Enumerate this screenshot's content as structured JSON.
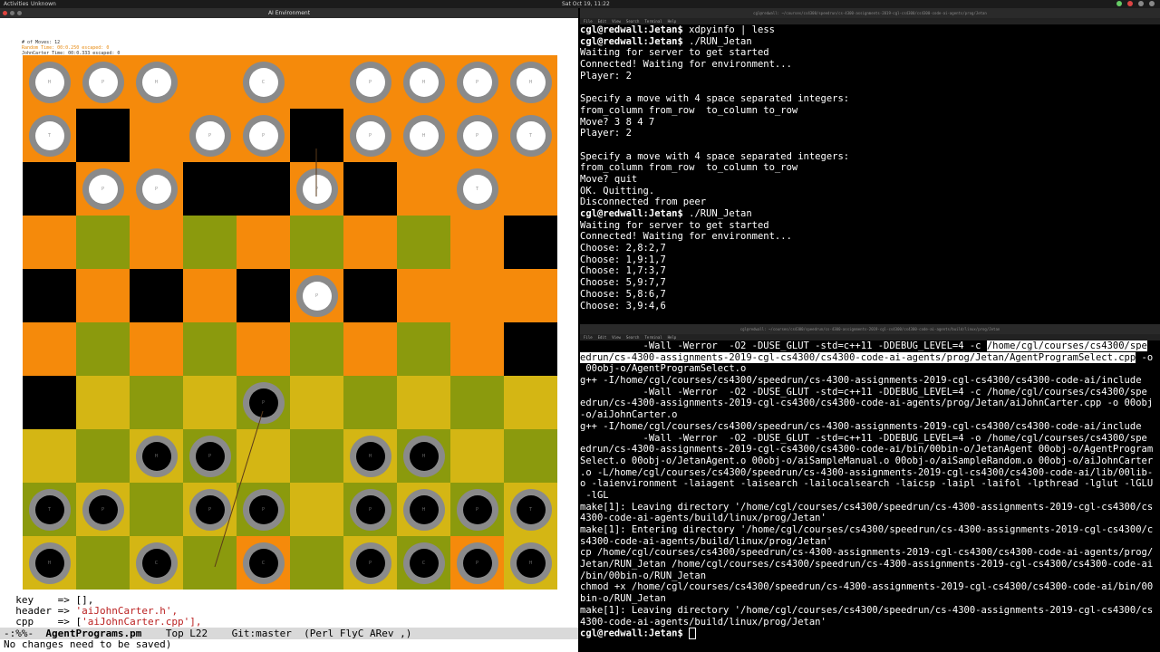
{
  "topbar": {
    "activities": "Activities",
    "app": "Unknown",
    "clock": "Sat Oct 19, 11:22"
  },
  "game": {
    "window_title": "AI Environment",
    "hud": [
      "# of Moves: 12",
      "Random Time: 00:0.250   escaped: 0",
      "JohnCarter Time: 00:0.333   escaped: 0"
    ],
    "board": {
      "cells": [
        [
          "O",
          "O",
          "O",
          "O",
          "O",
          "O",
          "O",
          "O",
          "O",
          "O"
        ],
        [
          "O",
          "K",
          "O",
          "O",
          "O",
          "K",
          "O",
          "O",
          "O",
          "O"
        ],
        [
          "K",
          "O",
          "O",
          "K",
          "K",
          "O",
          "K",
          "O",
          "O",
          "O"
        ],
        [
          "O",
          "G",
          "O",
          "G",
          "O",
          "G",
          "O",
          "G",
          "O",
          "K"
        ],
        [
          "K",
          "O",
          "K",
          "O",
          "K",
          "O",
          "K",
          "O",
          "O",
          "O"
        ],
        [
          "O",
          "G",
          "O",
          "G",
          "O",
          "G",
          "O",
          "G",
          "O",
          "K"
        ],
        [
          "K",
          "Y",
          "G",
          "Y",
          "G",
          "Y",
          "G",
          "Y",
          "G",
          "Y"
        ],
        [
          "Y",
          "G",
          "Y",
          "G",
          "Y",
          "G",
          "Y",
          "G",
          "Y",
          "G"
        ],
        [
          "G",
          "Y",
          "G",
          "Y",
          "G",
          "Y",
          "G",
          "Y",
          "G",
          "Y"
        ],
        [
          "Y",
          "G",
          "Y",
          "G",
          "O",
          "G",
          "Y",
          "G",
          "O",
          "Y"
        ]
      ],
      "pieces": [
        [
          "W",
          "W",
          "W",
          "",
          "W",
          "",
          "W",
          "W",
          "W",
          "W"
        ],
        [
          "W",
          "",
          "",
          "W",
          "W",
          "",
          "W",
          "W",
          "W",
          "W"
        ],
        [
          "",
          "W",
          "W",
          "",
          "",
          "W",
          "",
          "",
          "W",
          ""
        ],
        [
          "",
          "",
          "",
          "",
          "",
          "",
          "",
          "",
          "",
          ""
        ],
        [
          "",
          "",
          "",
          "",
          "",
          "W",
          "",
          "",
          "",
          ""
        ],
        [
          "",
          "",
          "",
          "",
          "",
          "",
          "",
          "",
          "",
          ""
        ],
        [
          "",
          "",
          "",
          "",
          "B",
          "",
          "",
          "",
          "",
          ""
        ],
        [
          "",
          "",
          "B",
          "B",
          "",
          "",
          "B",
          "B",
          "",
          ""
        ],
        [
          "B",
          "B",
          "",
          "B",
          "B",
          "",
          "B",
          "B",
          "B",
          "B"
        ],
        [
          "B",
          "",
          "B",
          "",
          "B",
          "",
          "B",
          "B",
          "B",
          "B"
        ]
      ],
      "piece_labels": [
        [
          "H",
          "P",
          "H",
          "",
          "C",
          "",
          "P",
          "H",
          "P",
          "H"
        ],
        [
          "T",
          "",
          "",
          "P",
          "P",
          "",
          "P",
          "H",
          "P",
          "T"
        ],
        [
          "",
          "P",
          "P",
          "",
          "",
          "P",
          "",
          "",
          "T",
          ""
        ],
        [
          "",
          "",
          "",
          "",
          "",
          "",
          "",
          "",
          "",
          ""
        ],
        [
          "",
          "",
          "",
          "",
          "",
          "P",
          "",
          "",
          "",
          ""
        ],
        [
          "",
          "",
          "",
          "",
          "",
          "",
          "",
          "",
          "",
          ""
        ],
        [
          "",
          "",
          "",
          "",
          "P",
          "",
          "",
          "",
          "",
          ""
        ],
        [
          "",
          "",
          "H",
          "P",
          "",
          "",
          "H",
          "H",
          "",
          ""
        ],
        [
          "T",
          "P",
          "",
          "P",
          "P",
          "",
          "P",
          "H",
          "P",
          "T"
        ],
        [
          "H",
          "",
          "C",
          "",
          "C",
          "",
          "P",
          "C",
          "P",
          "H"
        ]
      ],
      "colors": {
        "O": "#f58a0b",
        "K": "#000000",
        "G": "#8b9a0d",
        "Y": "#d4b614"
      }
    }
  },
  "emacs": {
    "lines": [
      {
        "pre": "  key    => [],",
        "str": ""
      },
      {
        "pre": "  header => ",
        "str": "'aiJohnCarter.h',"
      },
      {
        "pre": "  cpp    => [",
        "str": "'aiJohnCarter.cpp'],"
      }
    ],
    "modeline_pre": "-:%%-  ",
    "buffer": "AgentPrograms.pm",
    "modeline_post": "    Top L22    Git:master  (Perl FlyC ARev ,)",
    "echo": "No changes need to be saved)"
  },
  "term1": {
    "title": "cgl@redwall: ~/courses/cs4300/speedrun/cs-4300-assignments-2019-cgl-cs4300/cs4300-code-ai-agents/prog/Jetan",
    "menu": [
      "File",
      "Edit",
      "View",
      "Search",
      "Terminal",
      "Help"
    ],
    "lines": [
      {
        "p": "cgl@redwall",
        "d": ":Jetan$",
        "c": " xdpyinfo | less"
      },
      {
        "p": "cgl@redwall",
        "d": ":Jetan$",
        "c": " ./RUN_Jetan"
      },
      {
        "t": "Waiting for server to get started"
      },
      {
        "t": "Connected! Waiting for environment..."
      },
      {
        "t": "Player: 2"
      },
      {
        "t": ""
      },
      {
        "t": "Specify a move with 4 space separated integers:"
      },
      {
        "t": "from_column from_row  to_column to_row"
      },
      {
        "t": "Move? 3 8 4 7"
      },
      {
        "t": "Player: 2"
      },
      {
        "t": ""
      },
      {
        "t": "Specify a move with 4 space separated integers:"
      },
      {
        "t": "from_column from_row  to_column to_row"
      },
      {
        "t": "Move? quit"
      },
      {
        "t": "OK. Quitting."
      },
      {
        "t": "Disconnected from peer"
      },
      {
        "p": "cgl@redwall",
        "d": ":Jetan$",
        "c": " ./RUN_Jetan"
      },
      {
        "t": "Waiting for server to get started"
      },
      {
        "t": "Connected! Waiting for environment..."
      },
      {
        "t": "Choose: 2,8:2,7"
      },
      {
        "t": "Choose: 1,9:1,7"
      },
      {
        "t": "Choose: 1,7:3,7"
      },
      {
        "t": "Choose: 5,9:7,7"
      },
      {
        "t": "Choose: 5,8:6,7"
      },
      {
        "t": "Choose: 3,9:4,6"
      }
    ]
  },
  "term2": {
    "title": "cgl@redwall: ~/courses/cs4300/speedrun/cs-4300-assignments-2019-cgl-cs4300/cs4300-code-ai-agents/build/linux/prog/Jetan",
    "menu": [
      "File",
      "Edit",
      "View",
      "Search",
      "Terminal",
      "Help"
    ],
    "lines": [
      {
        "t": "           -Wall -Werror  -O2 -DUSE_GLUT -std=c++11 -DDEBUG_LEVEL=4 -c ",
        "s": "/home/cgl/courses/cs4300/spe"
      },
      {
        "s": "edrun/cs-4300-assignments-2019-cgl-cs4300/cs4300-code-ai-agents/prog/Jetan/AgentProgramSelect.cpp",
        "t": " -o"
      },
      {
        "t": " 00obj-o/AgentProgramSelect.o"
      },
      {
        "t": "g++ -I/home/cgl/courses/cs4300/speedrun/cs-4300-assignments-2019-cgl-cs4300/cs4300-code-ai/include"
      },
      {
        "t": "           -Wall -Werror  -O2 -DUSE_GLUT -std=c++11 -DDEBUG_LEVEL=4 -c /home/cgl/courses/cs4300/spe"
      },
      {
        "t": "edrun/cs-4300-assignments-2019-cgl-cs4300/cs4300-code-ai-agents/prog/Jetan/aiJohnCarter.cpp -o 00obj"
      },
      {
        "t": "-o/aiJohnCarter.o"
      },
      {
        "t": "g++ -I/home/cgl/courses/cs4300/speedrun/cs-4300-assignments-2019-cgl-cs4300/cs4300-code-ai/include"
      },
      {
        "t": "           -Wall -Werror  -O2 -DUSE_GLUT -std=c++11 -DDEBUG_LEVEL=4 -o /home/cgl/courses/cs4300/spe"
      },
      {
        "t": "edrun/cs-4300-assignments-2019-cgl-cs4300/cs4300-code-ai/bin/00bin-o/JetanAgent 00obj-o/AgentProgram"
      },
      {
        "t": "Select.o 00obj-o/JetanAgent.o 00obj-o/aiSampleManual.o 00obj-o/aiSampleRandom.o 00obj-o/aiJohnCarter"
      },
      {
        "t": ".o -L/home/cgl/courses/cs4300/speedrun/cs-4300-assignments-2019-cgl-cs4300/cs4300-code-ai/lib/00lib-"
      },
      {
        "t": "o -laienvironment -laiagent -laisearch -lailocalsearch -laicsp -laipl -laifol -lpthread -lglut -lGLU"
      },
      {
        "t": " -lGL"
      },
      {
        "t": "make[1]: Leaving directory '/home/cgl/courses/cs4300/speedrun/cs-4300-assignments-2019-cgl-cs4300/cs"
      },
      {
        "t": "4300-code-ai-agents/build/linux/prog/Jetan'"
      },
      {
        "t": "make[1]: Entering directory '/home/cgl/courses/cs4300/speedrun/cs-4300-assignments-2019-cgl-cs4300/c"
      },
      {
        "t": "s4300-code-ai-agents/build/linux/prog/Jetan'"
      },
      {
        "t": "cp /home/cgl/courses/cs4300/speedrun/cs-4300-assignments-2019-cgl-cs4300/cs4300-code-ai-agents/prog/"
      },
      {
        "t": "Jetan/RUN_Jetan /home/cgl/courses/cs4300/speedrun/cs-4300-assignments-2019-cgl-cs4300/cs4300-code-ai"
      },
      {
        "t": "/bin/00bin-o/RUN_Jetan"
      },
      {
        "t": "chmod +x /home/cgl/courses/cs4300/speedrun/cs-4300-assignments-2019-cgl-cs4300/cs4300-code-ai/bin/00"
      },
      {
        "t": "bin-o/RUN_Jetan"
      },
      {
        "t": "make[1]: Leaving directory '/home/cgl/courses/cs4300/speedrun/cs-4300-assignments-2019-cgl-cs4300/cs"
      },
      {
        "t": "4300-code-ai-agents/build/linux/prog/Jetan'"
      },
      {
        "p": "cgl@redwall",
        "d": ":Jetan$",
        "c": " ",
        "cursor": true
      }
    ]
  }
}
